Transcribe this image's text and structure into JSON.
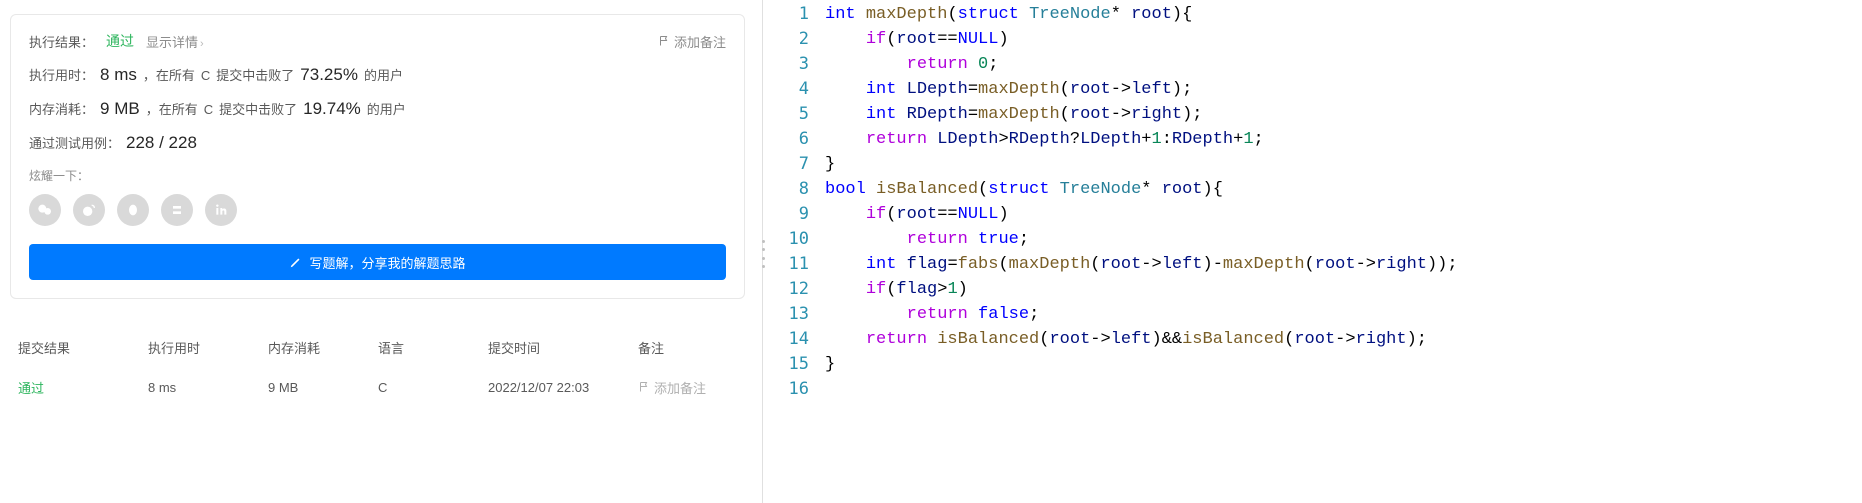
{
  "result": {
    "exec_result_label": "执行结果：",
    "status": "通过",
    "show_detail": "显示详情",
    "add_note": "添加备注",
    "runtime_label": "执行用时：",
    "runtime_value": "8 ms",
    "runtime_text1": "，在所有",
    "runtime_lang": "C",
    "runtime_text2": "提交中击败了",
    "runtime_pct": "73.25%",
    "runtime_text3": "的用户",
    "memory_label": "内存消耗：",
    "memory_value": "9 MB",
    "memory_text1": "，在所有",
    "memory_lang": "C",
    "memory_text2": "提交中击败了",
    "memory_pct": "19.74%",
    "memory_text3": "的用户",
    "cases_label": "通过测试用例：",
    "cases_value": "228 / 228",
    "brag_label": "炫耀一下：",
    "write_solution_btn": "写题解，分享我的解题思路"
  },
  "table": {
    "headers": {
      "result": "提交结果",
      "runtime": "执行用时",
      "memory": "内存消耗",
      "lang": "语言",
      "time": "提交时间",
      "note": "备注"
    },
    "row": {
      "result": "通过",
      "runtime": "8 ms",
      "memory": "9 MB",
      "lang": "C",
      "time": "2022/12/07 22:03",
      "note": "添加备注"
    }
  },
  "share_icons": [
    "wechat-icon",
    "weibo-icon",
    "qq-icon",
    "douban-icon",
    "linkedin-icon"
  ],
  "code_lines": [
    {
      "n": 1,
      "tokens": [
        [
          "type",
          "int"
        ],
        [
          "op",
          " "
        ],
        [
          "fn",
          "maxDepth"
        ],
        [
          "op",
          "("
        ],
        [
          "struct-kw",
          "struct"
        ],
        [
          "op",
          " "
        ],
        [
          "struct-name",
          "TreeNode"
        ],
        [
          "op",
          "* "
        ],
        [
          "ident",
          "root"
        ],
        [
          "op",
          "){"
        ]
      ]
    },
    {
      "n": 2,
      "tokens": [
        [
          "op",
          "    "
        ],
        [
          "ctrl",
          "if"
        ],
        [
          "op",
          "("
        ],
        [
          "ident",
          "root"
        ],
        [
          "op",
          "=="
        ],
        [
          "null",
          "NULL"
        ],
        [
          "op",
          ")"
        ]
      ]
    },
    {
      "n": 3,
      "tokens": [
        [
          "op",
          "        "
        ],
        [
          "ctrl",
          "return"
        ],
        [
          "op",
          " "
        ],
        [
          "num",
          "0"
        ],
        [
          "op",
          ";"
        ]
      ]
    },
    {
      "n": 4,
      "tokens": [
        [
          "op",
          "    "
        ],
        [
          "type",
          "int"
        ],
        [
          "op",
          " "
        ],
        [
          "ident",
          "LDepth"
        ],
        [
          "op",
          "="
        ],
        [
          "fn",
          "maxDepth"
        ],
        [
          "op",
          "("
        ],
        [
          "ident",
          "root"
        ],
        [
          "op",
          "->"
        ],
        [
          "ident",
          "left"
        ],
        [
          "op",
          ");"
        ]
      ]
    },
    {
      "n": 5,
      "tokens": [
        [
          "op",
          "    "
        ],
        [
          "type",
          "int"
        ],
        [
          "op",
          " "
        ],
        [
          "ident",
          "RDepth"
        ],
        [
          "op",
          "="
        ],
        [
          "fn",
          "maxDepth"
        ],
        [
          "op",
          "("
        ],
        [
          "ident",
          "root"
        ],
        [
          "op",
          "->"
        ],
        [
          "ident",
          "right"
        ],
        [
          "op",
          ");"
        ]
      ]
    },
    {
      "n": 6,
      "tokens": [
        [
          "op",
          "    "
        ],
        [
          "ctrl",
          "return"
        ],
        [
          "op",
          " "
        ],
        [
          "ident",
          "LDepth"
        ],
        [
          "op",
          ">"
        ],
        [
          "ident",
          "RDepth"
        ],
        [
          "op",
          "?"
        ],
        [
          "ident",
          "LDepth"
        ],
        [
          "op",
          "+"
        ],
        [
          "num",
          "1"
        ],
        [
          "op",
          ":"
        ],
        [
          "ident",
          "RDepth"
        ],
        [
          "op",
          "+"
        ],
        [
          "num",
          "1"
        ],
        [
          "op",
          ";"
        ]
      ]
    },
    {
      "n": 7,
      "tokens": [
        [
          "op",
          "}"
        ]
      ]
    },
    {
      "n": 8,
      "tokens": [
        [
          "type",
          "bool"
        ],
        [
          "op",
          " "
        ],
        [
          "fn",
          "isBalanced"
        ],
        [
          "op",
          "("
        ],
        [
          "struct-kw",
          "struct"
        ],
        [
          "op",
          " "
        ],
        [
          "struct-name",
          "TreeNode"
        ],
        [
          "op",
          "* "
        ],
        [
          "ident",
          "root"
        ],
        [
          "op",
          "){"
        ]
      ]
    },
    {
      "n": 9,
      "tokens": [
        [
          "op",
          "    "
        ],
        [
          "ctrl",
          "if"
        ],
        [
          "op",
          "("
        ],
        [
          "ident",
          "root"
        ],
        [
          "op",
          "=="
        ],
        [
          "null",
          "NULL"
        ],
        [
          "op",
          ")"
        ]
      ]
    },
    {
      "n": 10,
      "tokens": [
        [
          "op",
          "        "
        ],
        [
          "ctrl",
          "return"
        ],
        [
          "op",
          " "
        ],
        [
          "bool",
          "true"
        ],
        [
          "op",
          ";"
        ]
      ]
    },
    {
      "n": 11,
      "tokens": [
        [
          "op",
          "    "
        ],
        [
          "type",
          "int"
        ],
        [
          "op",
          " "
        ],
        [
          "ident",
          "flag"
        ],
        [
          "op",
          "="
        ],
        [
          "fn",
          "fabs"
        ],
        [
          "op",
          "("
        ],
        [
          "fn",
          "maxDepth"
        ],
        [
          "op",
          "("
        ],
        [
          "ident",
          "root"
        ],
        [
          "op",
          "->"
        ],
        [
          "ident",
          "left"
        ],
        [
          "op",
          ")-"
        ],
        [
          "fn",
          "maxDepth"
        ],
        [
          "op",
          "("
        ],
        [
          "ident",
          "root"
        ],
        [
          "op",
          "->"
        ],
        [
          "ident",
          "right"
        ],
        [
          "op",
          "));"
        ]
      ]
    },
    {
      "n": 12,
      "tokens": [
        [
          "op",
          "    "
        ],
        [
          "ctrl",
          "if"
        ],
        [
          "op",
          "("
        ],
        [
          "ident",
          "flag"
        ],
        [
          "op",
          ">"
        ],
        [
          "num",
          "1"
        ],
        [
          "op",
          ")"
        ]
      ]
    },
    {
      "n": 13,
      "tokens": [
        [
          "op",
          "        "
        ],
        [
          "ctrl",
          "return"
        ],
        [
          "op",
          " "
        ],
        [
          "bool",
          "false"
        ],
        [
          "op",
          ";"
        ]
      ]
    },
    {
      "n": 14,
      "tokens": [
        [
          "op",
          "    "
        ],
        [
          "ctrl",
          "return"
        ],
        [
          "op",
          " "
        ],
        [
          "fn",
          "isBalanced"
        ],
        [
          "op",
          "("
        ],
        [
          "ident",
          "root"
        ],
        [
          "op",
          "->"
        ],
        [
          "ident",
          "left"
        ],
        [
          "op",
          ")&&"
        ],
        [
          "fn",
          "isBalanced"
        ],
        [
          "op",
          "("
        ],
        [
          "ident",
          "root"
        ],
        [
          "op",
          "->"
        ],
        [
          "ident",
          "right"
        ],
        [
          "op",
          ");"
        ]
      ]
    },
    {
      "n": 15,
      "tokens": [
        [
          "op",
          "}"
        ]
      ]
    },
    {
      "n": 16,
      "tokens": []
    }
  ]
}
